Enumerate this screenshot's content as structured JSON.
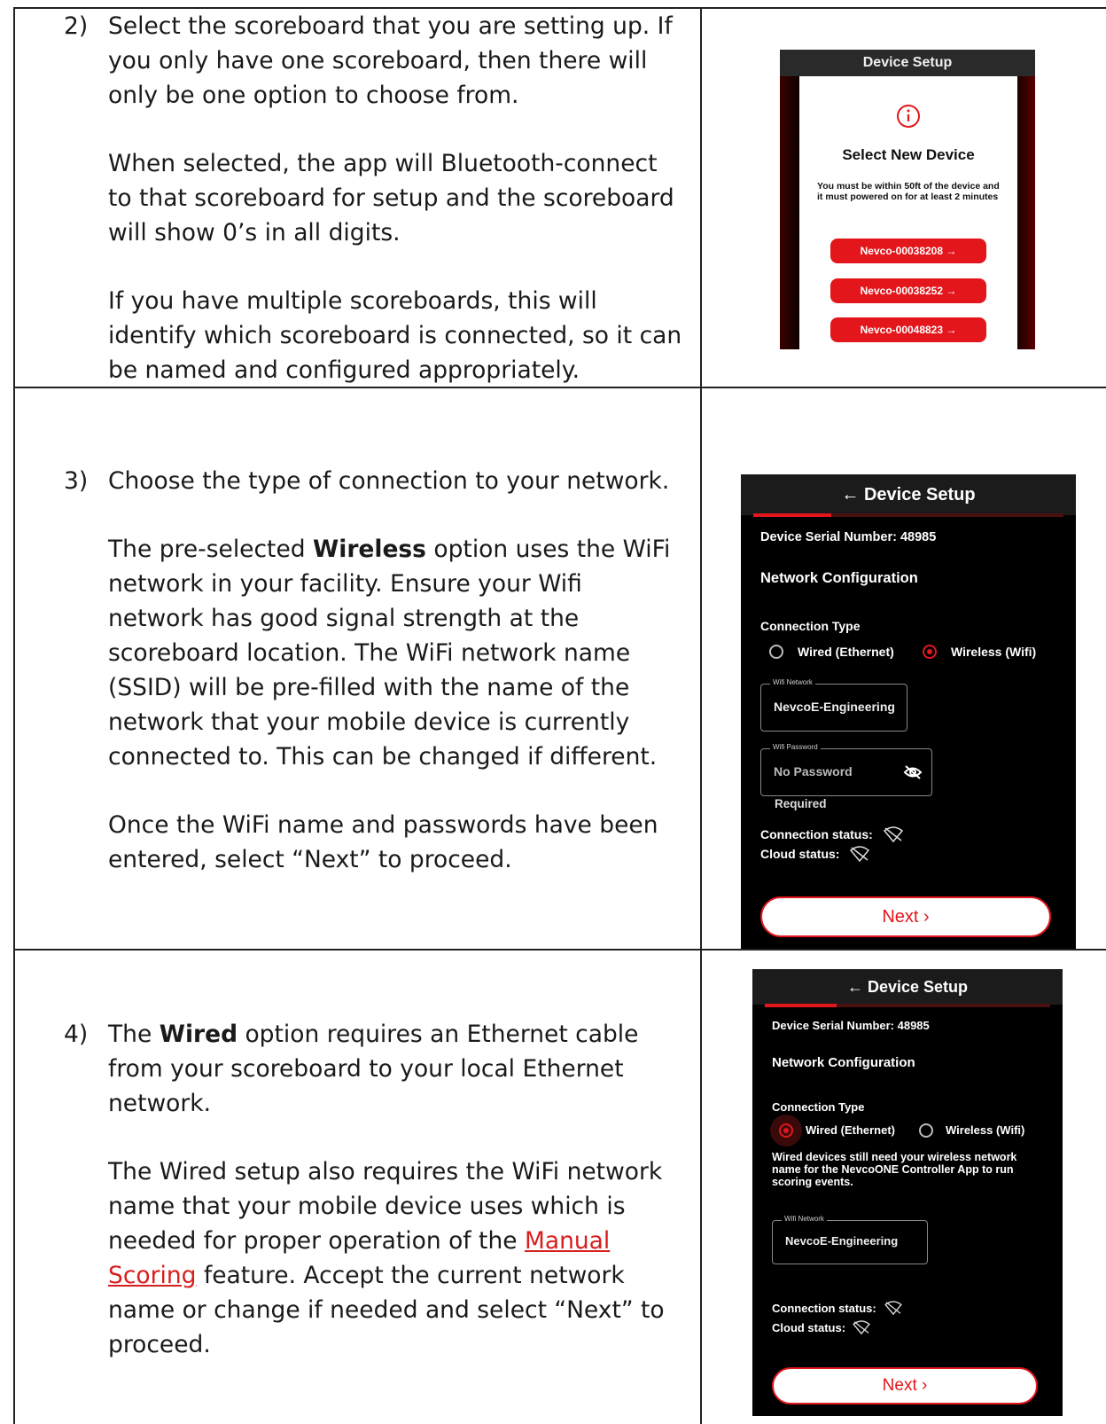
{
  "steps": [
    {
      "num": "2)",
      "paragraphs": [
        "Select the scoreboard that you are setting up. If you only have one scoreboard, then there will only be one option to choose from.",
        "When selected, the app will Bluetooth-connect to that scoreboard for setup and the scoreboard will show 0’s in all digits.",
        "If you have multiple scoreboards, this will identify which scoreboard is connected, so it can be named and configured appropriately."
      ]
    },
    {
      "num": "3)",
      "p1": "Choose the type of connection to your network.",
      "p2_pre": "The pre-selected ",
      "p2_bold": "Wireless",
      "p2_post": " option uses the WiFi network in your facility. Ensure your Wifi network has good signal strength at the scoreboard location. The WiFi network name (SSID) will be pre-filled with the name of the network that your mobile device is currently connected to. This can be changed if different.",
      "p3": "Once the WiFi name and passwords have been entered, select “Next” to proceed."
    },
    {
      "num": "4)",
      "p1_pre": "The ",
      "p1_bold": "Wired",
      "p1_post": " option requires an Ethernet cable from your scoreboard to your local Ethernet network.",
      "p2_pre": "The Wired setup also requires the WiFi network name that your mobile device uses which is needed for proper operation of the ",
      "p2_link": "Manual Scoring",
      "p2_post": " feature. Accept the current network name or change if needed and select “Next” to proceed."
    }
  ],
  "screen1": {
    "header": "Device Setup",
    "title": "Select New Device",
    "note": "You must be within 50ft of the device and it must powered on for at least 2 minutes",
    "devices": [
      "Nevco-00038208 →",
      "Nevco-00038252 →",
      "Nevco-00048823 →"
    ]
  },
  "screen2": {
    "header": "← Device Setup",
    "serial": "Device Serial Number: 48985",
    "section": "Network Configuration",
    "conn_type": "Connection Type",
    "opt_wired": "Wired (Ethernet)",
    "opt_wireless": "Wireless (Wifi)",
    "wifi_label": "Wifi Network",
    "wifi_value": "NevcoE-Engineering",
    "pass_label": "Wifi Password",
    "pass_value": "No Password",
    "required": "Required",
    "conn_status": "Connection status:",
    "cloud_status": "Cloud status:",
    "next": "Next ›"
  },
  "screen3": {
    "header": "← Device Setup",
    "serial": "Device Serial Number: 48985",
    "section": "Network Configuration",
    "conn_type": "Connection Type",
    "opt_wired": "Wired (Ethernet)",
    "opt_wireless": "Wireless (Wifi)",
    "note": "Wired devices still need your wireless network name for the NevcoONE Controller App to run scoring events.",
    "wifi_label": "Wifi Network",
    "wifi_value": "NevcoE-Engineering",
    "conn_status": "Connection status:",
    "cloud_status": "Cloud status:",
    "next": "Next ›"
  }
}
